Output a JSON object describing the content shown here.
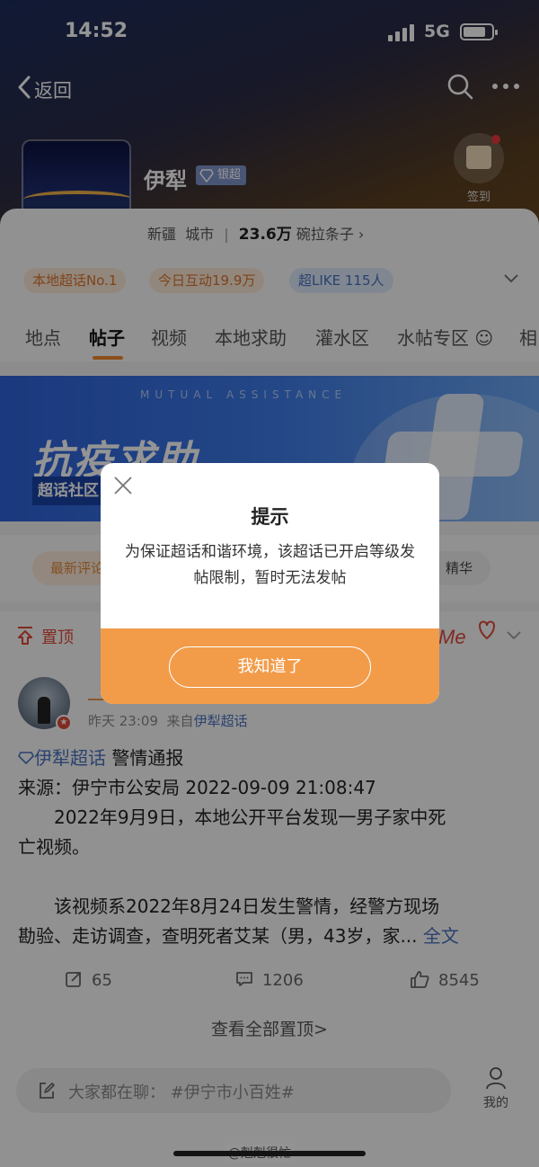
{
  "status_bar": {
    "time": "14:52",
    "network": "5G"
  },
  "nav": {
    "back_label": "返回"
  },
  "topic": {
    "name": "伊犁",
    "level_badge": "银超",
    "region": "新疆",
    "category": "城市",
    "followers": "23.6万",
    "fans_name": "碗拉条子",
    "signin_label": "签到"
  },
  "tags": [
    {
      "label": "本地超话No.1"
    },
    {
      "label": "今日互动19.9万"
    },
    {
      "label": "超LIKE 115人"
    }
  ],
  "tabs": [
    "地点",
    "帖子",
    "视频",
    "本地求助",
    "灌水区",
    "水帖专区",
    "相"
  ],
  "banner": {
    "subtitle": "MUTUAL ASSISTANCE",
    "headline": "抗疫求助",
    "community": "超话社区"
  },
  "filters": {
    "latest_comment": "最新评论",
    "featured": "精华"
  },
  "pinned": {
    "label": "置顶"
  },
  "post": {
    "time": "昨天 23:09",
    "from_prefix": "来自",
    "from_source": "伊犁超话",
    "topic_link": "伊犁超话",
    "title": "警情通报",
    "line1": "来源：伊宁市公安局 2022-09-09 21:08:47",
    "line2": "　　2022年9月9日，本地公开平台发现一男子家中死",
    "line3": "亡视频。",
    "line4": "　　该视频系2022年8月24日发生警情，经警方现场",
    "line5": "勘验、走访调查，查明死者艾某（男，43岁，家...",
    "full_text": "全文",
    "reposts": "65",
    "comments": "1206",
    "likes": "8545",
    "view_all": "查看全部置顶>"
  },
  "bottom": {
    "chat_placeholder": "大家都在聊： #伊宁市小百姓#",
    "mine_label": "我的",
    "watermark": "@剋剋很忙"
  },
  "dialog": {
    "title": "提示",
    "message": "为保证超话和谐环境，该超话已开启等级发帖限制，暂时无法发帖",
    "ok_label": "我知道了"
  },
  "colors": {
    "accent_orange": "#f29c4a",
    "link_blue": "#4a73c0",
    "pin_red": "#e0493a"
  }
}
